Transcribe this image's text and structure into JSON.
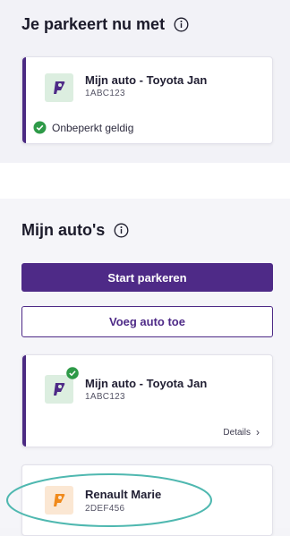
{
  "parking_now": {
    "title": "Je parkeert nu met",
    "car": {
      "name": "Mijn auto - Toyota Jan",
      "plate": "1ABC123",
      "status": "Onbeperkt geldig"
    }
  },
  "my_cars": {
    "title": "Mijn auto's",
    "start_button": "Start parkeren",
    "add_button": "Voeg auto toe",
    "cars": [
      {
        "name": "Mijn auto - Toyota Jan",
        "plate": "1ABC123",
        "details_label": "Details",
        "active": true
      },
      {
        "name": "Renault Marie",
        "plate": "2DEF456",
        "active": false
      }
    ]
  },
  "colors": {
    "brand_purple": "#4e2a87",
    "status_green": "#2e9a48",
    "logo_orange": "#f08a1c",
    "highlight_teal": "#4fb8b0"
  },
  "icons": [
    "info-icon",
    "check-circle-icon",
    "parking-logo-icon",
    "chevron-right-icon"
  ]
}
